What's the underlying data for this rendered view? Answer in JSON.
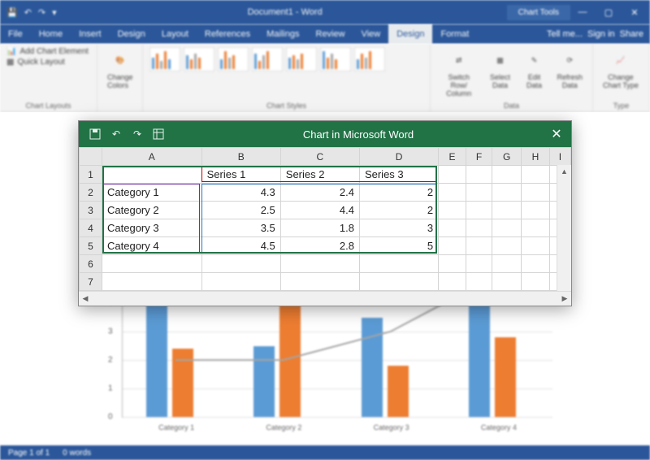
{
  "word": {
    "doc_title": "Document1 - Word",
    "chart_tools_label": "Chart Tools",
    "tabs": {
      "file": "File",
      "home": "Home",
      "insert": "Insert",
      "design_doc": "Design",
      "layout": "Layout",
      "references": "References",
      "mailings": "Mailings",
      "review": "Review",
      "view": "View",
      "design": "Design",
      "format": "Format"
    },
    "tell_me": "Tell me...",
    "signin": "Sign in",
    "share": "Share",
    "ribbon": {
      "add_chart_element": "Add Chart Element",
      "quick_layout": "Quick Layout",
      "chart_layouts": "Chart Layouts",
      "change_colors": "Change Colors",
      "chart_styles": "Chart Styles",
      "switch_row_col": "Switch Row/\nColumn",
      "select_data": "Select\nData",
      "edit_data": "Edit\nData",
      "refresh_data": "Refresh\nData",
      "data_group": "Data",
      "change_chart_type": "Change\nChart Type",
      "type_group": "Type"
    },
    "status": {
      "page": "Page 1 of 1",
      "words": "0 words"
    }
  },
  "excel": {
    "title": "Chart in Microsoft Word",
    "columns": [
      "A",
      "B",
      "C",
      "D",
      "E",
      "F",
      "G",
      "H",
      "I"
    ],
    "headers": {
      "b": "Series 1",
      "c": "Series 2",
      "d": "Series 3"
    },
    "rows": [
      {
        "n": "1",
        "a": "",
        "b": "Series 1",
        "c": "Series 2",
        "d": "Series 3"
      },
      {
        "n": "2",
        "a": "Category 1",
        "b": "4.3",
        "c": "2.4",
        "d": "2"
      },
      {
        "n": "3",
        "a": "Category 2",
        "b": "2.5",
        "c": "4.4",
        "d": "2"
      },
      {
        "n": "4",
        "a": "Category 3",
        "b": "3.5",
        "c": "1.8",
        "d": "3"
      },
      {
        "n": "5",
        "a": "Category 4",
        "b": "4.5",
        "c": "2.8",
        "d": "5"
      },
      {
        "n": "6",
        "a": "",
        "b": "",
        "c": "",
        "d": ""
      },
      {
        "n": "7",
        "a": "",
        "b": "",
        "c": "",
        "d": ""
      }
    ]
  },
  "chart_data": {
    "type": "bar",
    "categories": [
      "Category 1",
      "Category 2",
      "Category 3",
      "Category 4"
    ],
    "series": [
      {
        "name": "Series 1",
        "values": [
          4.3,
          2.5,
          3.5,
          4.5
        ],
        "color": "#5b9bd5"
      },
      {
        "name": "Series 2",
        "values": [
          2.4,
          4.4,
          1.8,
          2.8
        ],
        "color": "#ed7d31"
      },
      {
        "name": "Series 3 (line)",
        "values": [
          2,
          2,
          3,
          5
        ],
        "color": "#a5a5a5"
      }
    ],
    "ylim": [
      0,
      5
    ],
    "yticks": [
      0,
      1,
      2,
      3,
      4,
      5
    ],
    "xlabel": "",
    "ylabel": "",
    "title": ""
  }
}
